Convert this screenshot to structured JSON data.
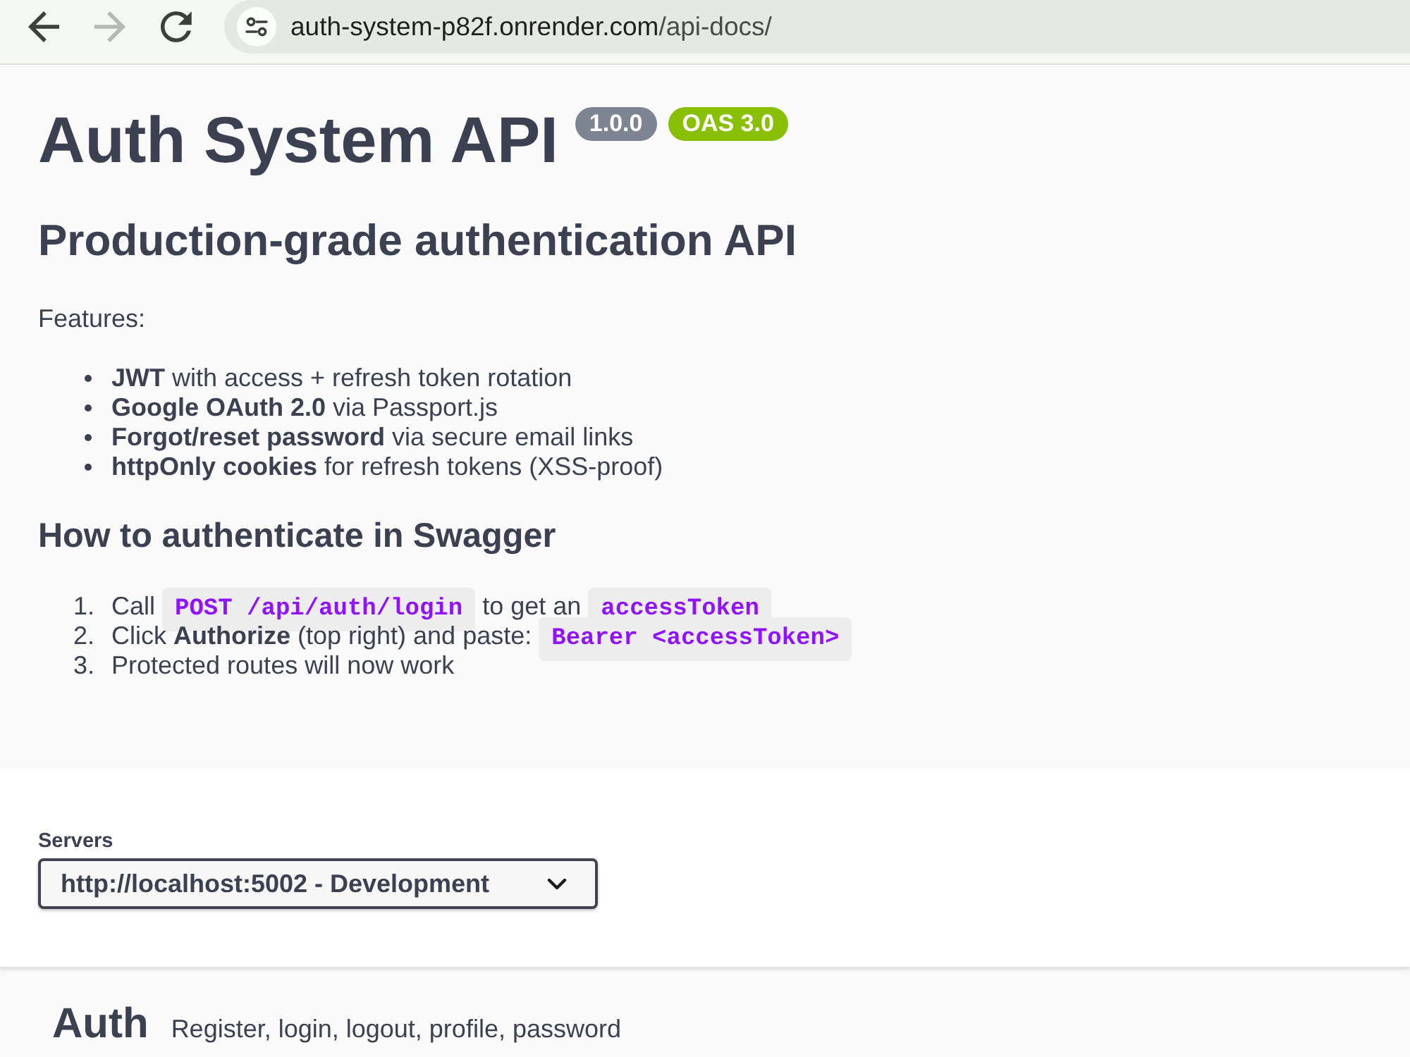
{
  "browser": {
    "back": {
      "disabled": false
    },
    "forward": {
      "disabled": true
    },
    "url_host": "auth-system-p82f.onrender.com",
    "url_path": "/api-docs/"
  },
  "info": {
    "title": "Auth System API",
    "badges": [
      {
        "label": "1.0.0",
        "color": "#7d8492"
      },
      {
        "label": "OAS 3.0",
        "color": "#89bf04"
      }
    ],
    "subtitle": "Production-grade authentication API",
    "features_label": "Features:",
    "features": [
      "**JWT** with access + refresh token rotation",
      "**Google OAuth 2.0** via Passport.js",
      "**Forgot/reset password** via secure email links",
      "**httpOnly cookies** for refresh tokens (XSS-proof)"
    ],
    "auth_heading": "How to authenticate in Swagger",
    "steps": [
      {
        "number": "1.",
        "parts": [
          {
            "kind": "text",
            "text": "Call"
          },
          {
            "kind": "code",
            "text": "POST /api/auth/login"
          },
          {
            "kind": "text",
            "text": "to get an"
          },
          {
            "kind": "code",
            "text": "accessToken"
          }
        ]
      },
      {
        "number": "2.",
        "parts": [
          {
            "kind": "text",
            "text": "Click **Authorize** (top right) and paste:"
          },
          {
            "kind": "code",
            "text": "Bearer <accessToken>"
          }
        ]
      },
      {
        "number": "3.",
        "parts": [
          {
            "kind": "text",
            "text": "Protected routes will now work"
          }
        ]
      }
    ]
  },
  "servers": {
    "label": "Servers",
    "value": "http://localhost:5002 - Development"
  },
  "tags": [
    {
      "name": "Auth",
      "description": "Register, login, logout, profile, password"
    }
  ]
}
